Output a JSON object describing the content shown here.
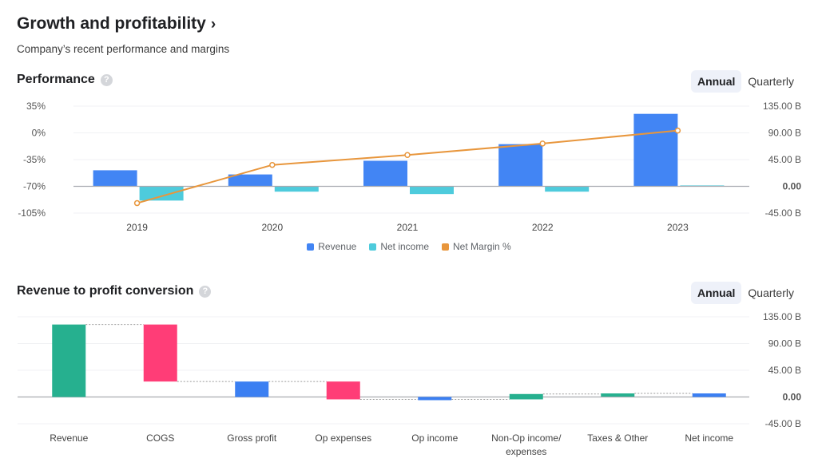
{
  "header": {
    "title": "Growth and profitability",
    "title_chevron": "›",
    "subtitle": "Company’s recent performance and margins"
  },
  "performance": {
    "title": "Performance",
    "help_icon": "?",
    "toggle": {
      "options": [
        "Annual",
        "Quarterly"
      ],
      "selected": "Annual"
    }
  },
  "conversion": {
    "title": "Revenue to profit conversion",
    "help_icon": "?",
    "toggle": {
      "options": [
        "Annual",
        "Quarterly"
      ],
      "selected": "Annual"
    }
  },
  "colors": {
    "revenue": "#4285f4",
    "net_income": "#4ecbdc",
    "net_margin": "#e8963c",
    "positive": "#26b08f",
    "negative": "#ff3d77",
    "subtotal": "#3b7ff2"
  },
  "chart_data": [
    {
      "type": "bar",
      "title": "Performance",
      "categories": [
        "2019",
        "2020",
        "2021",
        "2022",
        "2023"
      ],
      "series": [
        {
          "name": "Revenue",
          "axis": "right",
          "kind": "bar",
          "values": [
            27,
            20,
            43,
            71,
            122
          ]
        },
        {
          "name": "Net income",
          "axis": "right",
          "kind": "bar",
          "values": [
            -24,
            -9,
            -13,
            -9,
            1.5
          ]
        },
        {
          "name": "Net Margin %",
          "axis": "left",
          "kind": "line",
          "values": [
            -92,
            -42,
            -29,
            -14,
            3
          ]
        }
      ],
      "left_axis": {
        "ticks": [
          "35%",
          "0%",
          "-35%",
          "-70%",
          "-105%"
        ],
        "values": [
          35,
          0,
          -35,
          -70,
          -105
        ],
        "ylim": [
          -105,
          35
        ]
      },
      "right_axis": {
        "ticks": [
          "135.00 B",
          "90.00 B",
          "45.00 B",
          "0.00",
          "-45.00 B"
        ],
        "values": [
          135,
          90,
          45,
          0,
          -45
        ],
        "ylim": [
          -45,
          135
        ],
        "unit": "B"
      },
      "legend": [
        "Revenue",
        "Net income",
        "Net Margin %"
      ],
      "legend_position": "bottom",
      "grid": true
    },
    {
      "type": "bar",
      "subtype": "waterfall",
      "title": "Revenue to profit conversion",
      "categories": [
        "Revenue",
        "COGS",
        "Gross profit",
        "Op expenses",
        "Op income",
        "Non-Op income/\nexpenses",
        "Taxes & Other",
        "Net income"
      ],
      "steps": [
        {
          "label": "Revenue",
          "kind": "total",
          "start": 0,
          "end": 122
        },
        {
          "label": "COGS",
          "kind": "decrease",
          "start": 122,
          "end": 26
        },
        {
          "label": "Gross profit",
          "kind": "subtotal",
          "start": 0,
          "end": 26
        },
        {
          "label": "Op expenses",
          "kind": "decrease",
          "start": 26,
          "end": -4
        },
        {
          "label": "Op income",
          "kind": "subtotal",
          "start": 0,
          "end": -4
        },
        {
          "label": "Non-Op income/ expenses",
          "kind": "increase",
          "start": -4,
          "end": 5
        },
        {
          "label": "Taxes & Other",
          "kind": "increase",
          "start": 5,
          "end": 6
        },
        {
          "label": "Net income",
          "kind": "subtotal",
          "start": 0,
          "end": 6
        }
      ],
      "right_axis": {
        "ticks": [
          "135.00 B",
          "90.00 B",
          "45.00 B",
          "0.00",
          "-45.00 B"
        ],
        "values": [
          135,
          90,
          45,
          0,
          -45
        ],
        "ylim": [
          -45,
          135
        ],
        "unit": "B"
      },
      "grid": true
    }
  ]
}
